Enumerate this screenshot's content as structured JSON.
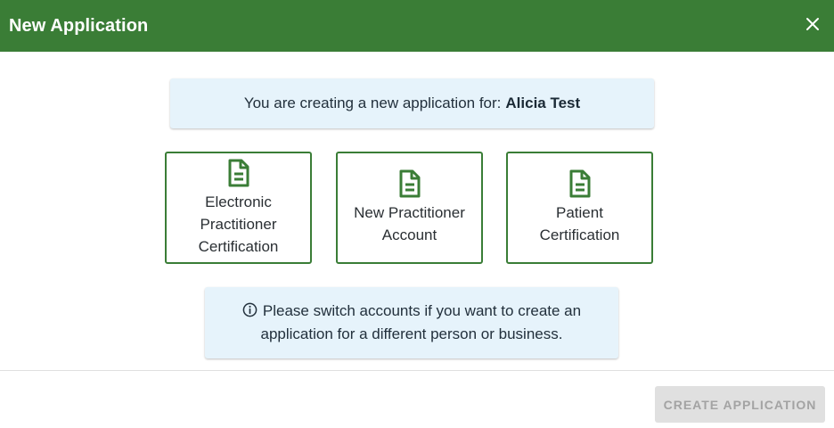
{
  "header": {
    "title": "New Application",
    "close_icon": "close-icon"
  },
  "applicant_banner": {
    "prefix": "You are creating a new application for:",
    "name": "Alicia Test"
  },
  "options": [
    {
      "label_lines": [
        "Electronic",
        "Practitioner",
        "Certification"
      ],
      "icon": "document-icon"
    },
    {
      "label_lines": [
        "New Practitioner",
        "Account"
      ],
      "icon": "document-icon"
    },
    {
      "label_lines": [
        "Patient",
        "Certification"
      ],
      "icon": "document-icon"
    }
  ],
  "info_banner": {
    "icon": "info-icon",
    "line1": "Please switch accounts if you want to create an",
    "line2": "application for a different person or business."
  },
  "footer": {
    "create_label": "CREATE APPLICATION"
  },
  "colors": {
    "brand_green": "#3a7d36",
    "banner_blue": "#e6f3fb",
    "disabled_button": "#e0e0e0"
  }
}
